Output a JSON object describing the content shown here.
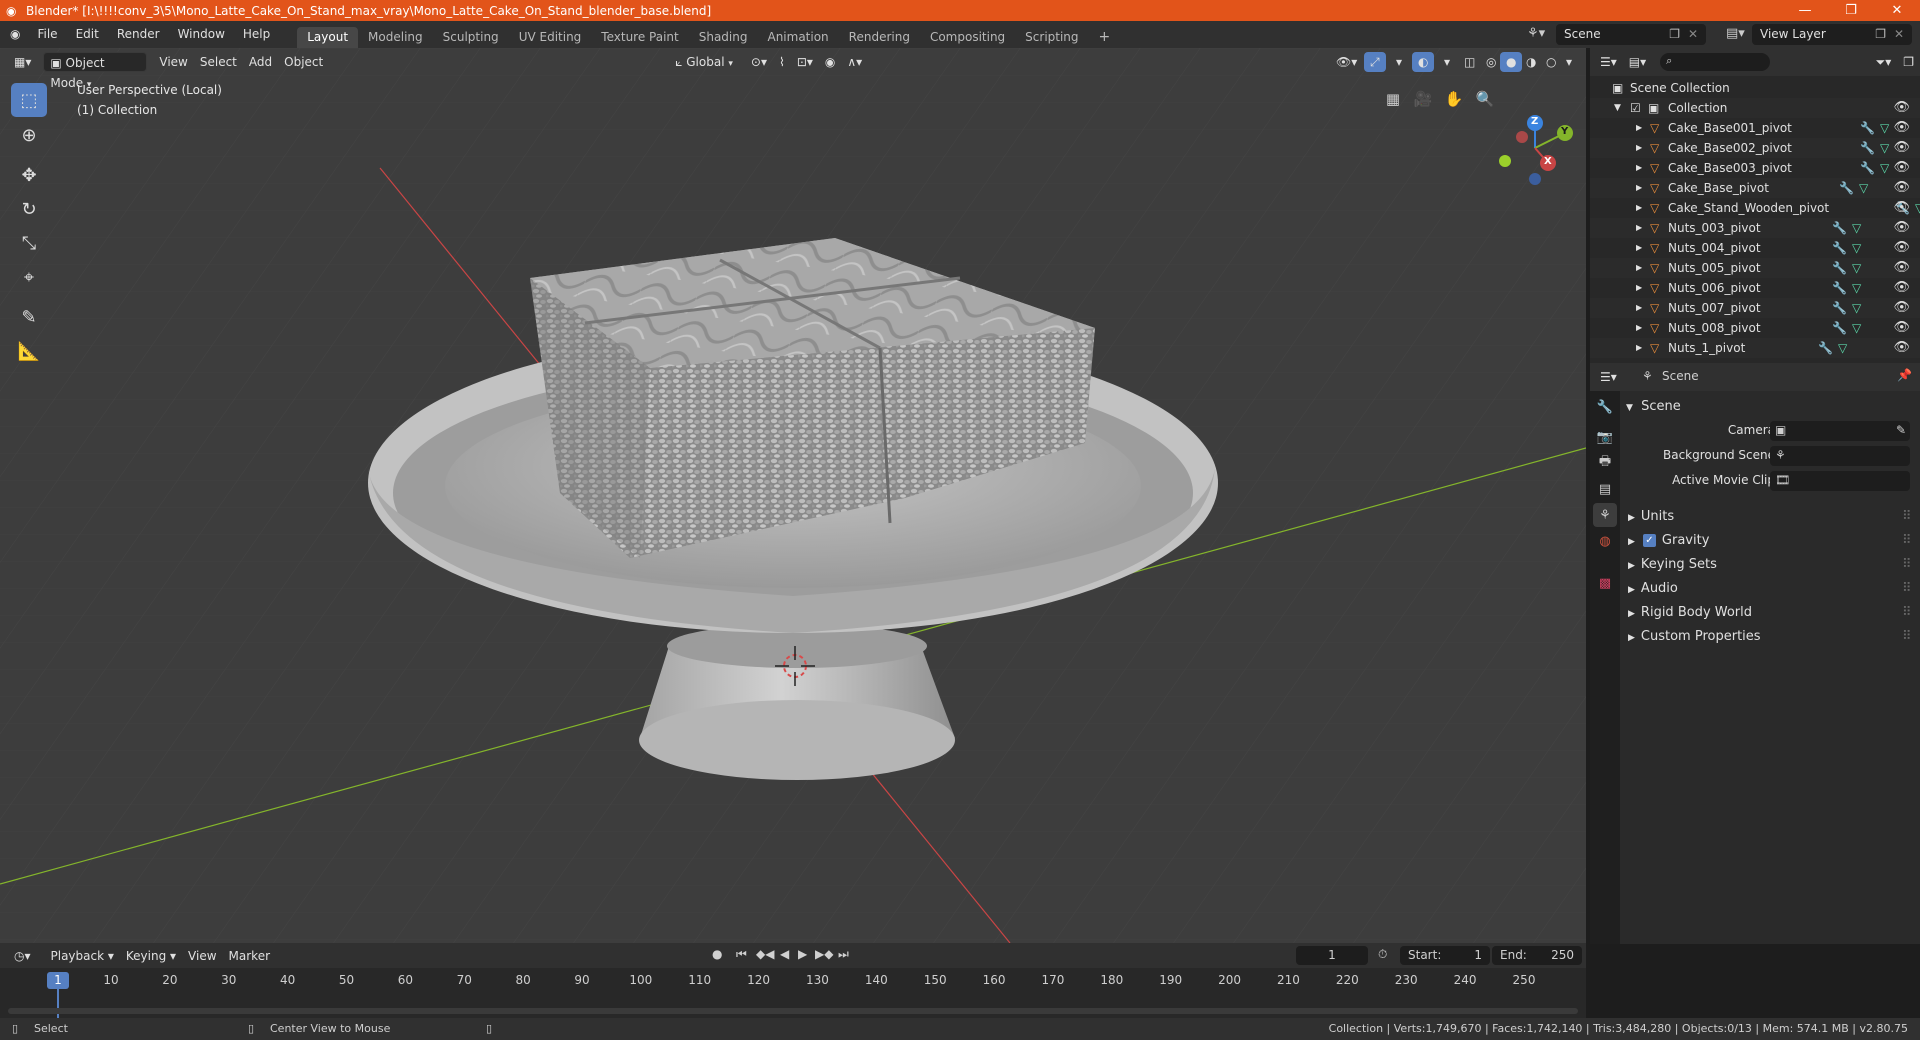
{
  "titlebar": {
    "title": "Blender* [I:\\!!!!conv_3\\5\\Mono_Latte_Cake_On_Stand_max_vray\\Mono_Latte_Cake_On_Stand_blender_base.blend]",
    "minimize": "—",
    "maximize": "❐",
    "close": "✕"
  },
  "menubar": {
    "items": [
      "File",
      "Edit",
      "Render",
      "Window",
      "Help"
    ],
    "workspaces": [
      "Layout",
      "Modeling",
      "Sculpting",
      "UV Editing",
      "Texture Paint",
      "Shading",
      "Animation",
      "Rendering",
      "Compositing",
      "Scripting"
    ],
    "add_tab": "+",
    "scene_label": "Scene",
    "view_layer_label": "View Layer"
  },
  "viewport_header": {
    "mode": "Object Mode",
    "menus": [
      "View",
      "Select",
      "Add",
      "Object"
    ],
    "orientation": "Global"
  },
  "viewport": {
    "perspective": "User Perspective (Local)",
    "collection": "(1) Collection",
    "gizmo": {
      "x": "X",
      "y": "Y",
      "z": "Z"
    }
  },
  "outliner": {
    "search_placeholder": "",
    "scene_collection": "Scene Collection",
    "collection": "Collection",
    "objects": [
      "Cake_Base001_pivot",
      "Cake_Base002_pivot",
      "Cake_Base003_pivot",
      "Cake_Base_pivot",
      "Cake_Stand_Wooden_pivot",
      "Nuts_003_pivot",
      "Nuts_004_pivot",
      "Nuts_005_pivot",
      "Nuts_006_pivot",
      "Nuts_007_pivot",
      "Nuts_008_pivot",
      "Nuts_1_pivot"
    ]
  },
  "properties": {
    "context": "Scene",
    "panel_title": "Scene",
    "camera_label": "Camera",
    "background_scene_label": "Background Scene",
    "active_movie_clip_label": "Active Movie Clip",
    "subpanels": [
      "Units",
      "Gravity",
      "Keying Sets",
      "Audio",
      "Rigid Body World",
      "Custom Properties"
    ],
    "gravity_checked": true
  },
  "timeline": {
    "menus": [
      "Playback",
      "Keying",
      "View",
      "Marker"
    ],
    "current_frame": "1",
    "start_label": "Start:",
    "start_value": "1",
    "end_label": "End:",
    "end_value": "250",
    "ruler_current": "1",
    "ruler_ticks": [
      "10",
      "20",
      "30",
      "40",
      "50",
      "60",
      "70",
      "80",
      "90",
      "100",
      "110",
      "120",
      "130",
      "140",
      "150",
      "160",
      "170",
      "180",
      "190",
      "200",
      "210",
      "220",
      "230",
      "240",
      "250"
    ]
  },
  "statusbar": {
    "left_action": "Select",
    "middle_action": "Center View to Mouse",
    "stats": "Collection | Verts:1,749,670 | Faces:1,742,140 | Tris:3,484,280 | Objects:0/13 | Mem: 574.1 MB | v2.80.75"
  },
  "colors": {
    "titlebar": "#e2541a",
    "accent_blue": "#5680c2",
    "viewport_bg": "#3d3d3d",
    "x_axis": "#c94545",
    "y_axis": "#84b52b",
    "z_axis": "#3a84e0"
  }
}
